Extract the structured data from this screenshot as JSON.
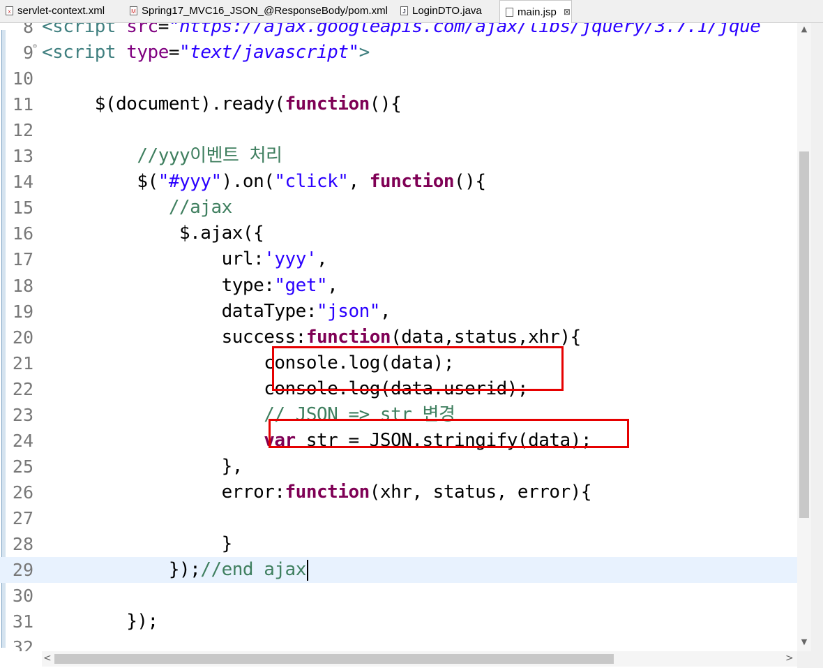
{
  "tabs": [
    {
      "label": "servlet-context.xml",
      "icon": "xml-file-icon",
      "active": false
    },
    {
      "label": "Spring17_MVC16_JSON_@ResponseBody/pom.xml",
      "icon": "maven-pom-icon",
      "active": false
    },
    {
      "label": "LoginDTO.java",
      "icon": "java-file-icon",
      "active": false
    },
    {
      "label": "main.jsp",
      "icon": "jsp-file-icon",
      "active": true,
      "close": "⊠"
    }
  ],
  "editor": {
    "current_line": 29,
    "highlight_color": "#e60000",
    "lines": [
      {
        "n": "8",
        "text": "<script src=\"https://ajax.googleapis.com/ajax/libs/jquery/3.7.1/jque"
      },
      {
        "n": "9",
        "text": "<script type=\"text/javascript\">"
      },
      {
        "n": "10",
        "text": ""
      },
      {
        "n": "11",
        "text": "     $(document).ready(function(){"
      },
      {
        "n": "12",
        "text": ""
      },
      {
        "n": "13",
        "text": "         //yyy이벤트 처리"
      },
      {
        "n": "14",
        "text": "         $(\"#yyy\").on(\"click\", function(){"
      },
      {
        "n": "15",
        "text": "            //ajax"
      },
      {
        "n": "16",
        "text": "             $.ajax({"
      },
      {
        "n": "17",
        "text": "                 url:'yyy',"
      },
      {
        "n": "18",
        "text": "                 type:\"get\","
      },
      {
        "n": "19",
        "text": "                 dataType:\"json\","
      },
      {
        "n": "20",
        "text": "                 success:function(data,status,xhr){"
      },
      {
        "n": "21",
        "text": "                     console.log(data);"
      },
      {
        "n": "22",
        "text": "                     console.log(data.userid);"
      },
      {
        "n": "23",
        "text": "                     // JSON => str 변경"
      },
      {
        "n": "24",
        "text": "                     var str = JSON.stringify(data);"
      },
      {
        "n": "25",
        "text": "                 },"
      },
      {
        "n": "26",
        "text": "                 error:function(xhr, status, error){"
      },
      {
        "n": "27",
        "text": ""
      },
      {
        "n": "28",
        "text": "                 }"
      },
      {
        "n": "29",
        "text": "            });//end ajax"
      },
      {
        "n": "30",
        "text": ""
      },
      {
        "n": "31",
        "text": "        });"
      },
      {
        "n": "32",
        "text": ""
      }
    ]
  },
  "scrollbar": {
    "up_icon": "▲",
    "down_icon": "▼",
    "left_icon": "<",
    "right_icon": ">"
  }
}
